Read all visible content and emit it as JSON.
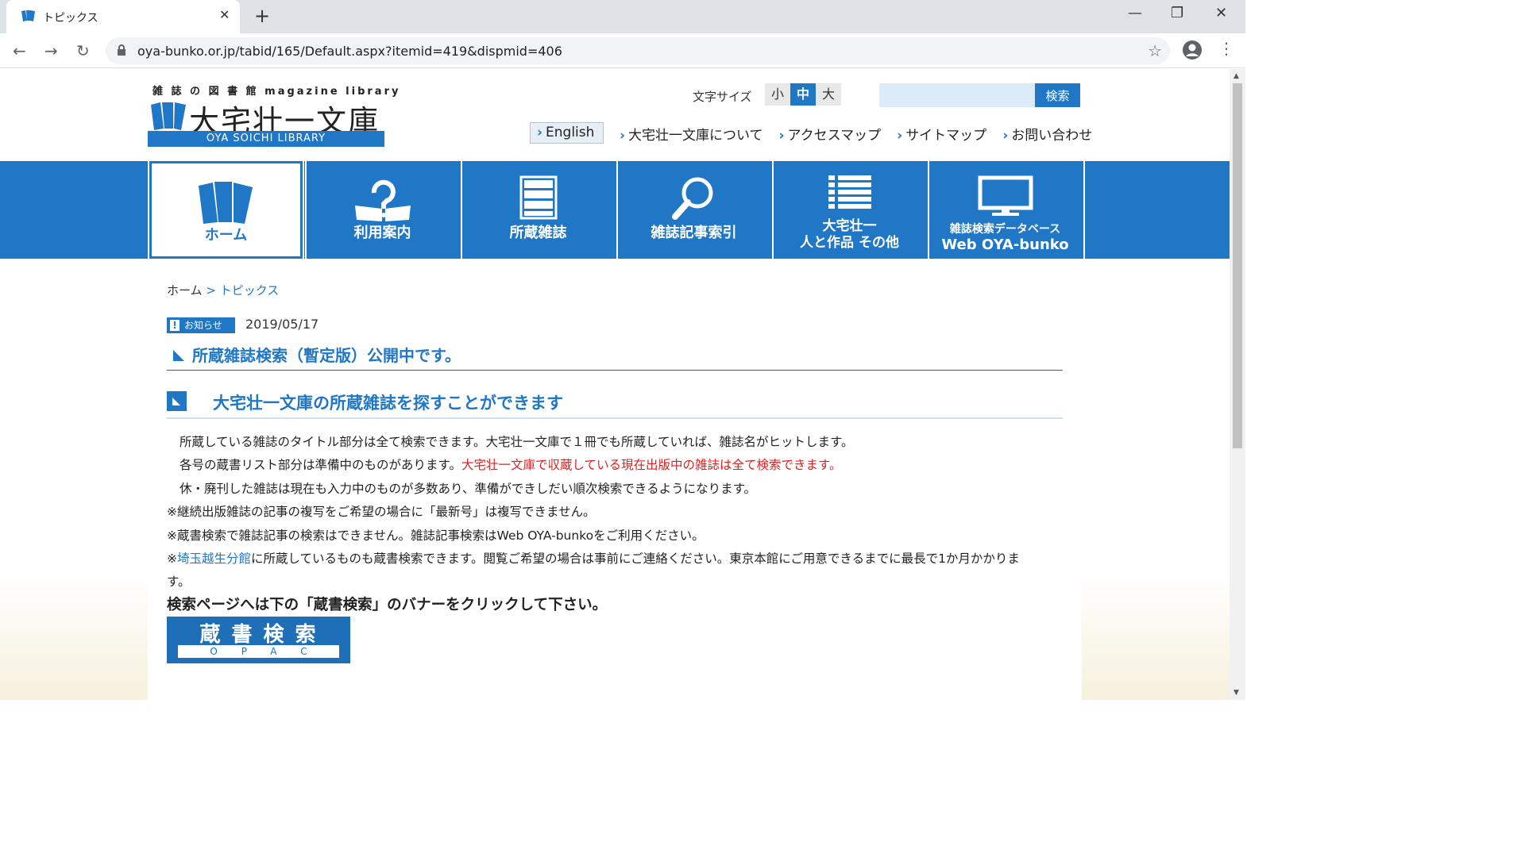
{
  "browser": {
    "tab_title": "トピックス",
    "url": "oya-bunko.or.jp/tabid/165/Default.aspx?itemid=419&dispmid=406"
  },
  "header": {
    "logo_top": "雑 誌 の 図 書 館   magazine library",
    "logo_main": "大宅壮一文庫",
    "logo_sub": "OYA SOICHI LIBRARY",
    "font_size_label": "文字サイズ",
    "font_sizes": [
      "小",
      "中",
      "大"
    ],
    "search_button": "検索",
    "english_label": "English",
    "links": [
      "大宅壮一文庫について",
      "アクセスマップ",
      "サイトマップ",
      "お問い合わせ"
    ]
  },
  "nav": {
    "home": "ホーム",
    "guide": "利用案内",
    "holdings": "所蔵雑誌",
    "index": "雑誌記事索引",
    "others_line1": "大宅壮一",
    "others_line2": "人と作品 その他",
    "db_line1": "雑誌検索データベース",
    "db_line2": "Web OYA-bunko"
  },
  "breadcrumb": {
    "home": "ホーム",
    "sep": ">",
    "current": "トピックス"
  },
  "article": {
    "badge": "お知らせ",
    "date": "2019/05/17",
    "title": "所蔵雑誌検索（暫定版）公開中です。",
    "heading": "大宅壮一文庫の所蔵雑誌を探すことができます",
    "p1": "所蔵している雑誌のタイトル部分は全て検索できます。大宅壮一文庫で１冊でも所蔵していれば、雑誌名がヒットします。",
    "p2a": "各号の蔵書リスト部分は準備中のものがあります。",
    "p2b": "大宅壮一文庫で収蔵している現在出版中の雑誌は全て検索できます。",
    "p3": "休・廃刊した雑誌は現在も入力中のものが多数あり、準備ができしだい順次検索できるようになります。",
    "n1": "※継続出版雑誌の記事の複写をご希望の場合に「最新号」は複写できません。",
    "n2": "※蔵書検索で雑誌記事の検索はできません。雑誌記事検索はWeb OYA-bunkoをご利用ください。",
    "n3_prefix": "※",
    "n3_link": "埼玉越生分館",
    "n3_rest": "に所蔵しているものも蔵書検索できます。閲覧ご希望の場合は事前にご連絡ください。東京本館にご用意できるまでに最長で1か月かかりま",
    "n3_wrap": "す。",
    "cta": "検索ページへは下の「蔵書検索」のバナーをクリックして下さい。",
    "banner_title": "蔵書検索",
    "banner_sub": "OPAC"
  },
  "colors": {
    "brand_blue": "#1f77c6",
    "alert_red": "#e02020"
  }
}
